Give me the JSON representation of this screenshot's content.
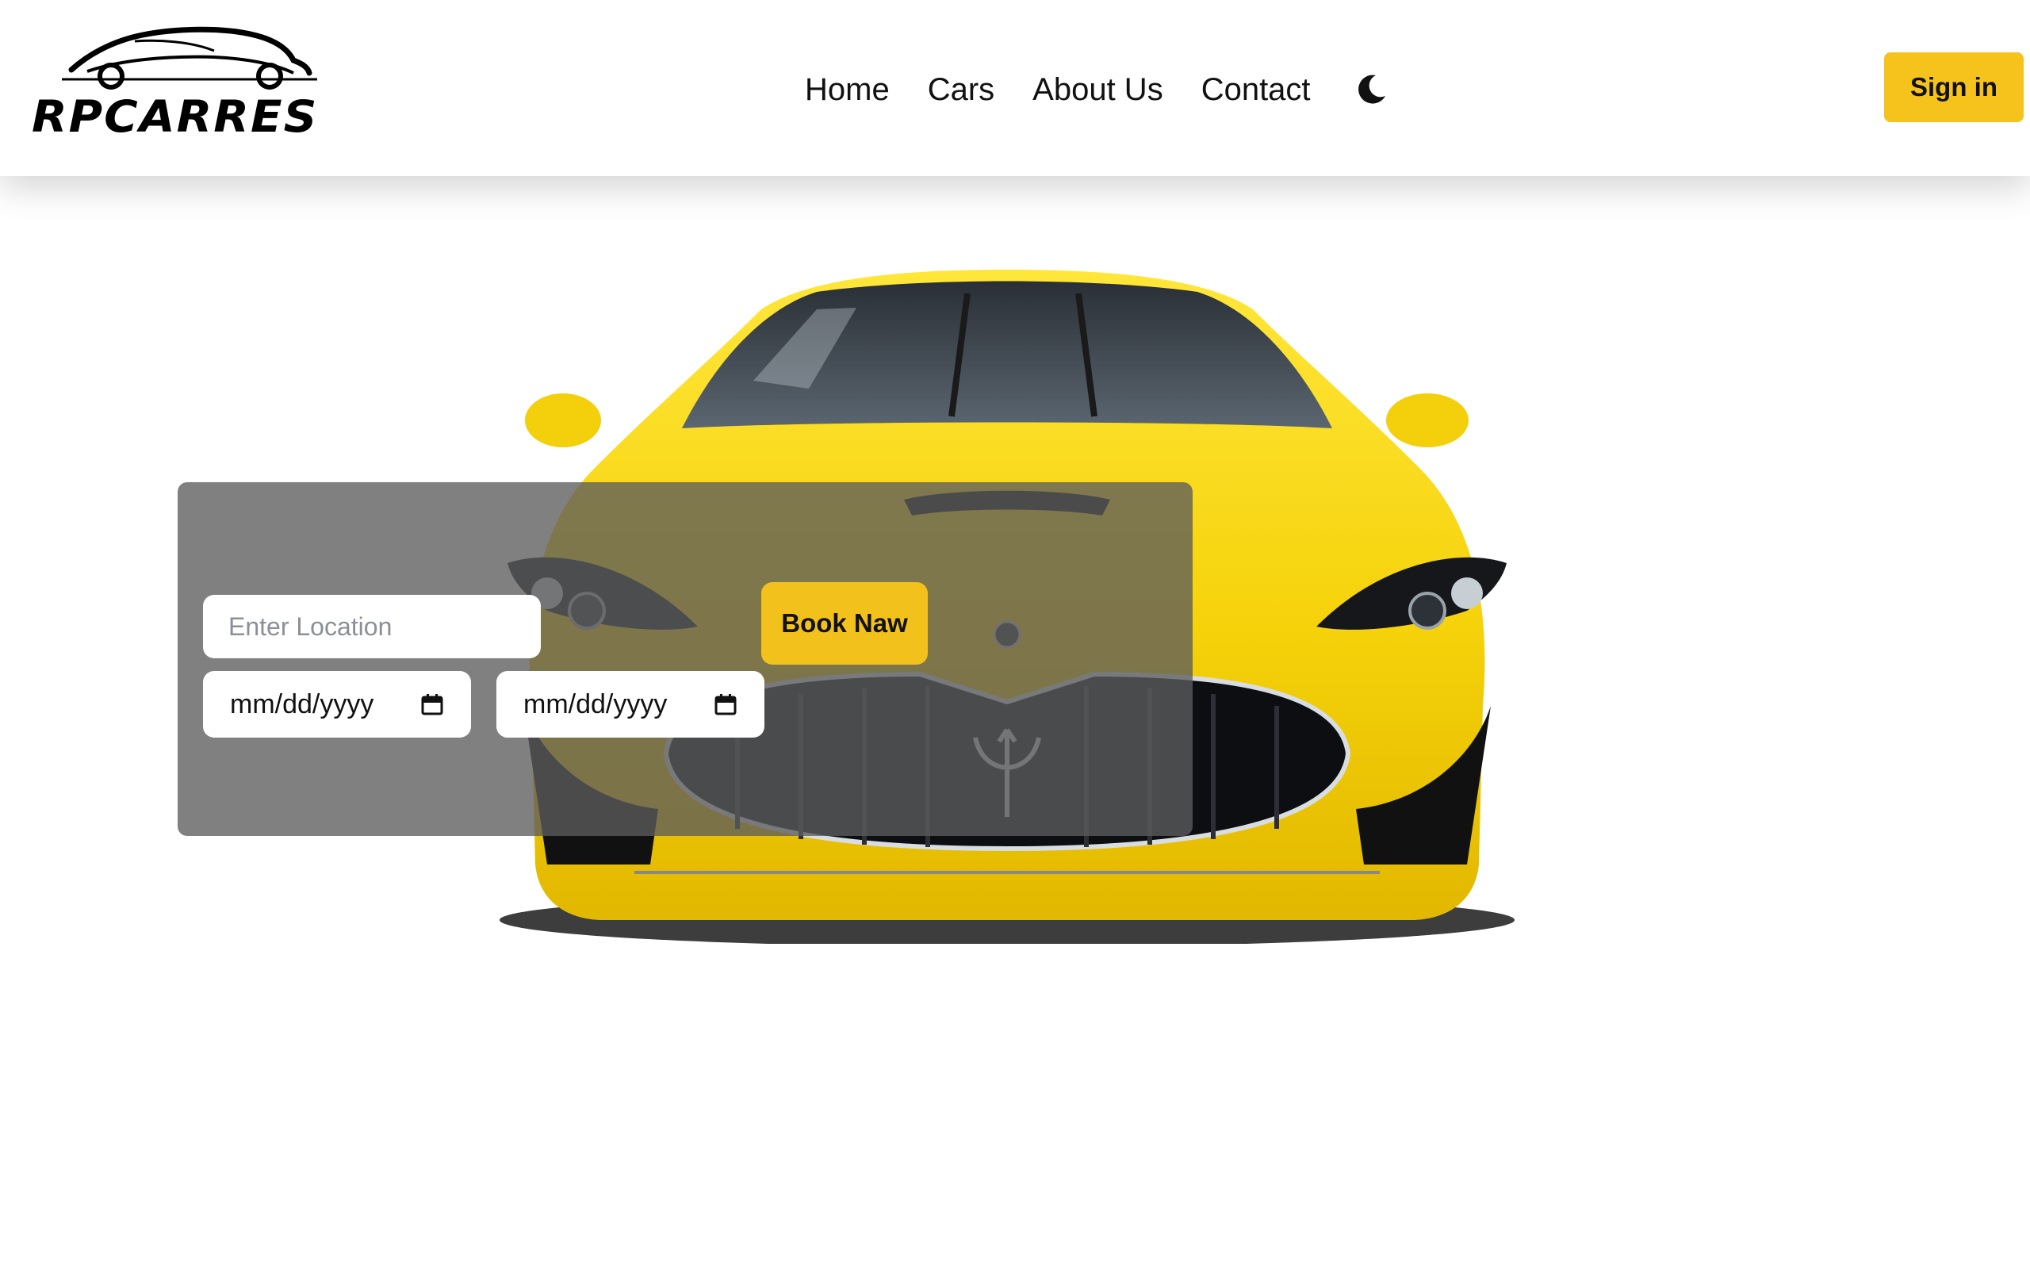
{
  "brand": {
    "name": "RPCARRES"
  },
  "nav": {
    "items": [
      {
        "label": "Home"
      },
      {
        "label": "Cars"
      },
      {
        "label": "About Us"
      },
      {
        "label": "Contact"
      }
    ],
    "theme_toggle_icon": "moon-icon"
  },
  "header": {
    "signin_label": "Sign in"
  },
  "booking": {
    "location_placeholder": "Enter Location",
    "start_date_value": "mm/dd/yyyy",
    "end_date_value": "mm/dd/yyyy",
    "calendar_icon": "calendar-icon",
    "book_label": "Book Naw"
  },
  "colors": {
    "accent": "#f6c21c",
    "panel_overlay": "#5c5c5c",
    "car_body": "#f5d90c"
  }
}
